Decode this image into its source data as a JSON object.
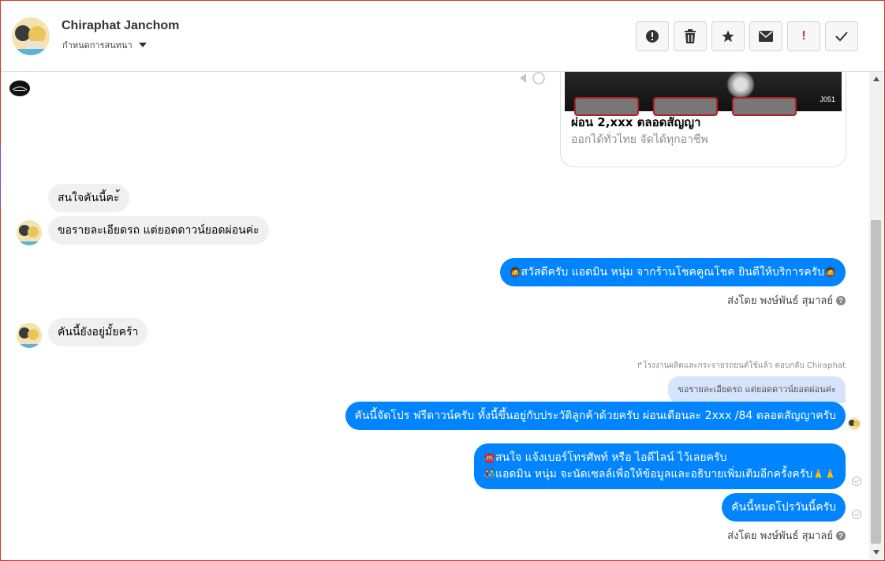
{
  "header": {
    "name": "Chiraphat Janchom",
    "subtitle": "กำหนดการสนทนา"
  },
  "toolbar": [
    {
      "name": "alert",
      "icon": "exclamation-circle-icon"
    },
    {
      "name": "delete",
      "icon": "trash-icon"
    },
    {
      "name": "star",
      "icon": "star-icon"
    },
    {
      "name": "mail",
      "icon": "envelope-icon"
    },
    {
      "name": "important",
      "icon": "exclamation-icon",
      "label": "!"
    },
    {
      "name": "done",
      "icon": "checkmark-icon"
    }
  ],
  "card": {
    "image_code": "J051",
    "title": "ผ่อน 2,xxx ตลอดสัญญา",
    "description": "ออกได้ทั่วไทย จัดได้ทุกอาชีพ"
  },
  "messages": {
    "m1": "สนใจคันนี้คะ้",
    "m2": "ขอรายละเอียดรถ แต่ยอดดาวน์ยอดผ่อนค่ะ",
    "m3": "สวัสดีครับ แอดมิน หนุ่ม จากร้านโชคคูณโชค ยินดีให้บริการครับ",
    "m3_sent_by": "ส่งโดย พงษ์พันธ์ สุมาลย์",
    "m4": "คันนี้ยังอยู่มั้ยคร้า",
    "reply_meta": "โรงงานผลิตและกระจายรถยนต์ใช้แล้ว ตอบกลับ Chiraphat",
    "quoted": "ขอรายละเอียดรถ แต่ยอดดาวน์ยอดผ่อนค่ะ",
    "m5": "คันนี้จัดโปร ฟรีดาวน์ครับ ทั้งนี้ขึ้นอยู่กับประวัติลูกค้าด้วยครับ  ผ่อนเดือนละ 2xxx /84 ตลอดสัญญาครับ",
    "m6_line1": "สนใจ แจ้งเบอร์โทรศัพท์ หรือ ไอดีไลน์  ไว้เลยครับ",
    "m6_line2": "แอดมิน หนุ่ม จะนัดเซลล์เพื่อให้ข้อมูลและอธิบายเพิ่มเติมอีกครั้งครับ",
    "m7": "คันนี้หมดโปรวันนี้ครับ",
    "m7_sent_by": "ส่งโดย พงษ์พันธ์ สุมาลย์"
  },
  "colors": {
    "outgoing": "#0084ff",
    "incoming": "#f0f0f0",
    "quoted": "#d6e4fb",
    "important": "#e0302b"
  }
}
